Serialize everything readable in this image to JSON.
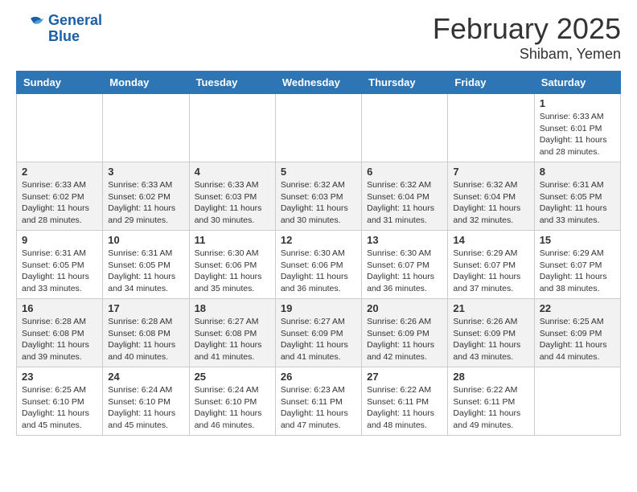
{
  "header": {
    "logo_line1": "General",
    "logo_line2": "Blue",
    "month_title": "February 2025",
    "location": "Shibam, Yemen"
  },
  "weekdays": [
    "Sunday",
    "Monday",
    "Tuesday",
    "Wednesday",
    "Thursday",
    "Friday",
    "Saturday"
  ],
  "weeks": [
    [
      {
        "num": "",
        "info": ""
      },
      {
        "num": "",
        "info": ""
      },
      {
        "num": "",
        "info": ""
      },
      {
        "num": "",
        "info": ""
      },
      {
        "num": "",
        "info": ""
      },
      {
        "num": "",
        "info": ""
      },
      {
        "num": "1",
        "info": "Sunrise: 6:33 AM\nSunset: 6:01 PM\nDaylight: 11 hours and 28 minutes."
      }
    ],
    [
      {
        "num": "2",
        "info": "Sunrise: 6:33 AM\nSunset: 6:02 PM\nDaylight: 11 hours and 28 minutes."
      },
      {
        "num": "3",
        "info": "Sunrise: 6:33 AM\nSunset: 6:02 PM\nDaylight: 11 hours and 29 minutes."
      },
      {
        "num": "4",
        "info": "Sunrise: 6:33 AM\nSunset: 6:03 PM\nDaylight: 11 hours and 30 minutes."
      },
      {
        "num": "5",
        "info": "Sunrise: 6:32 AM\nSunset: 6:03 PM\nDaylight: 11 hours and 30 minutes."
      },
      {
        "num": "6",
        "info": "Sunrise: 6:32 AM\nSunset: 6:04 PM\nDaylight: 11 hours and 31 minutes."
      },
      {
        "num": "7",
        "info": "Sunrise: 6:32 AM\nSunset: 6:04 PM\nDaylight: 11 hours and 32 minutes."
      },
      {
        "num": "8",
        "info": "Sunrise: 6:31 AM\nSunset: 6:05 PM\nDaylight: 11 hours and 33 minutes."
      }
    ],
    [
      {
        "num": "9",
        "info": "Sunrise: 6:31 AM\nSunset: 6:05 PM\nDaylight: 11 hours and 33 minutes."
      },
      {
        "num": "10",
        "info": "Sunrise: 6:31 AM\nSunset: 6:05 PM\nDaylight: 11 hours and 34 minutes."
      },
      {
        "num": "11",
        "info": "Sunrise: 6:30 AM\nSunset: 6:06 PM\nDaylight: 11 hours and 35 minutes."
      },
      {
        "num": "12",
        "info": "Sunrise: 6:30 AM\nSunset: 6:06 PM\nDaylight: 11 hours and 36 minutes."
      },
      {
        "num": "13",
        "info": "Sunrise: 6:30 AM\nSunset: 6:07 PM\nDaylight: 11 hours and 36 minutes."
      },
      {
        "num": "14",
        "info": "Sunrise: 6:29 AM\nSunset: 6:07 PM\nDaylight: 11 hours and 37 minutes."
      },
      {
        "num": "15",
        "info": "Sunrise: 6:29 AM\nSunset: 6:07 PM\nDaylight: 11 hours and 38 minutes."
      }
    ],
    [
      {
        "num": "16",
        "info": "Sunrise: 6:28 AM\nSunset: 6:08 PM\nDaylight: 11 hours and 39 minutes."
      },
      {
        "num": "17",
        "info": "Sunrise: 6:28 AM\nSunset: 6:08 PM\nDaylight: 11 hours and 40 minutes."
      },
      {
        "num": "18",
        "info": "Sunrise: 6:27 AM\nSunset: 6:08 PM\nDaylight: 11 hours and 41 minutes."
      },
      {
        "num": "19",
        "info": "Sunrise: 6:27 AM\nSunset: 6:09 PM\nDaylight: 11 hours and 41 minutes."
      },
      {
        "num": "20",
        "info": "Sunrise: 6:26 AM\nSunset: 6:09 PM\nDaylight: 11 hours and 42 minutes."
      },
      {
        "num": "21",
        "info": "Sunrise: 6:26 AM\nSunset: 6:09 PM\nDaylight: 11 hours and 43 minutes."
      },
      {
        "num": "22",
        "info": "Sunrise: 6:25 AM\nSunset: 6:09 PM\nDaylight: 11 hours and 44 minutes."
      }
    ],
    [
      {
        "num": "23",
        "info": "Sunrise: 6:25 AM\nSunset: 6:10 PM\nDaylight: 11 hours and 45 minutes."
      },
      {
        "num": "24",
        "info": "Sunrise: 6:24 AM\nSunset: 6:10 PM\nDaylight: 11 hours and 45 minutes."
      },
      {
        "num": "25",
        "info": "Sunrise: 6:24 AM\nSunset: 6:10 PM\nDaylight: 11 hours and 46 minutes."
      },
      {
        "num": "26",
        "info": "Sunrise: 6:23 AM\nSunset: 6:11 PM\nDaylight: 11 hours and 47 minutes."
      },
      {
        "num": "27",
        "info": "Sunrise: 6:22 AM\nSunset: 6:11 PM\nDaylight: 11 hours and 48 minutes."
      },
      {
        "num": "28",
        "info": "Sunrise: 6:22 AM\nSunset: 6:11 PM\nDaylight: 11 hours and 49 minutes."
      },
      {
        "num": "",
        "info": ""
      }
    ]
  ]
}
